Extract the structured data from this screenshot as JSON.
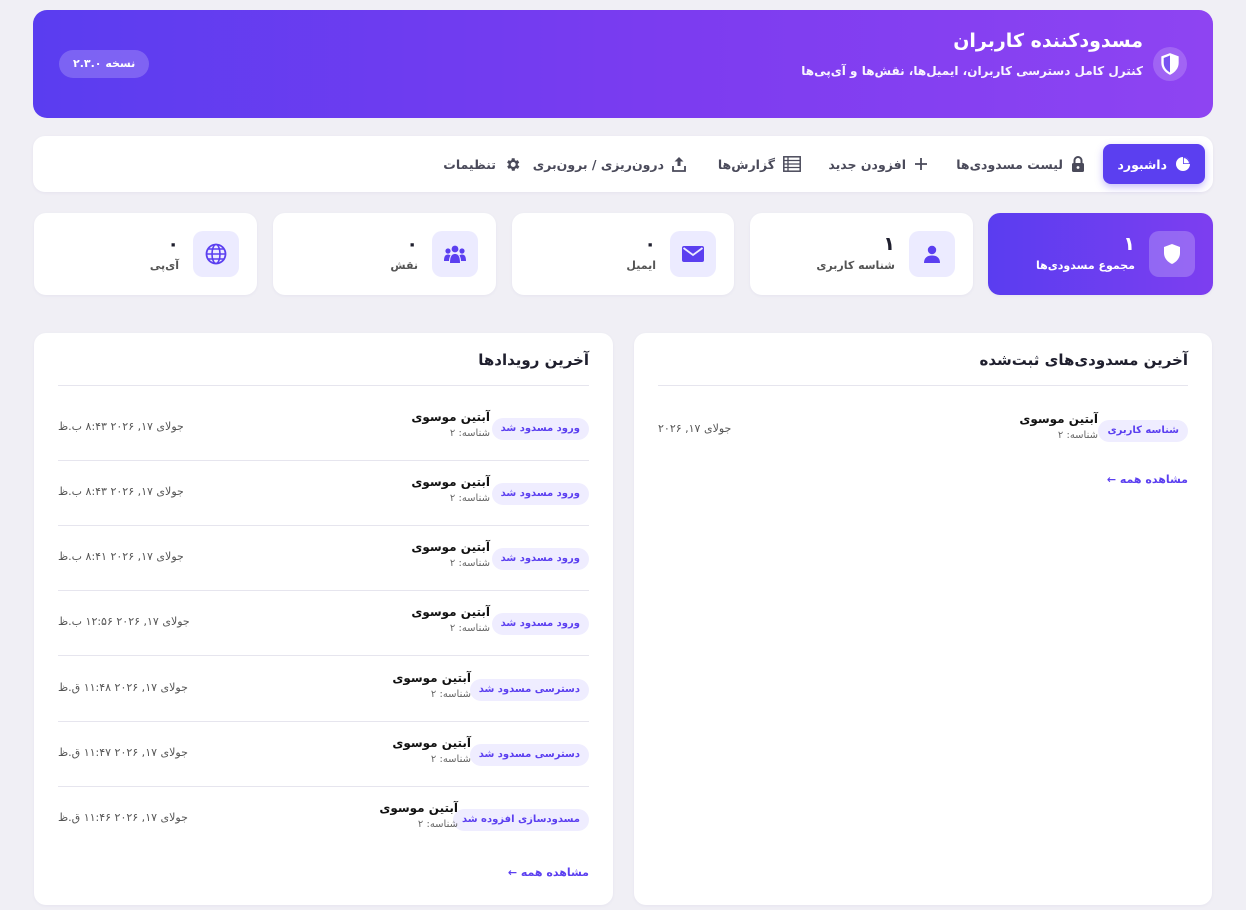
{
  "header": {
    "title": "مسدودکننده کاربران",
    "subtitle": "کنترل کامل دسترسی کاربران، ایمیل‌ها، نقش‌ها و آی‌پی‌ها",
    "version": "نسخه ۲.۳.۰"
  },
  "nav": {
    "dashboard": "داشبورد",
    "blocked_list": "لیست مسدودی‌ها",
    "add_new": "افزودن جدید",
    "reports": "گزارش‌ها",
    "import_export": "درون‌ریزی / برون‌بری",
    "settings": "تنظیمات"
  },
  "stats": [
    {
      "label": "مجموع مسدودی‌ها",
      "value": "۱"
    },
    {
      "label": "شناسه کاربری",
      "value": "۱"
    },
    {
      "label": "ایمیل",
      "value": "۰"
    },
    {
      "label": "نقش",
      "value": "۰"
    },
    {
      "label": "آی‌پی",
      "value": "۰"
    }
  ],
  "recent_blocks": {
    "title": "آخرین مسدودی‌های ثبت‌شده",
    "items": [
      {
        "type": "شناسه کاربری",
        "name": "آبتین موسوی",
        "ident": "شناسه: ۲",
        "date": "جولای ۱۷, ۲۰۲۶"
      }
    ],
    "see_all": "مشاهده همه ←"
  },
  "recent_events": {
    "title": "آخرین رویدادها",
    "items": [
      {
        "event": "ورود مسدود شد",
        "name": "آبتین موسوی",
        "ident": "شناسه: ۲",
        "date": "جولای ۱۷, ۲۰۲۶ ۸:۴۳ ب.ظ"
      },
      {
        "event": "ورود مسدود شد",
        "name": "آبتین موسوی",
        "ident": "شناسه: ۲",
        "date": "جولای ۱۷, ۲۰۲۶ ۸:۴۳ ب.ظ"
      },
      {
        "event": "ورود مسدود شد",
        "name": "آبتین موسوی",
        "ident": "شناسه: ۲",
        "date": "جولای ۱۷, ۲۰۲۶ ۸:۴۱ ب.ظ"
      },
      {
        "event": "ورود مسدود شد",
        "name": "آبتین موسوی",
        "ident": "شناسه: ۲",
        "date": "جولای ۱۷, ۲۰۲۶ ۱۲:۵۶ ب.ظ"
      },
      {
        "event": "دسترسی مسدود شد",
        "name": "آبتین موسوی",
        "ident": "شناسه: ۲",
        "date": "جولای ۱۷, ۲۰۲۶ ۱۱:۴۸ ق.ظ"
      },
      {
        "event": "دسترسی مسدود شد",
        "name": "آبتین موسوی",
        "ident": "شناسه: ۲",
        "date": "جولای ۱۷, ۲۰۲۶ ۱۱:۴۷ ق.ظ"
      },
      {
        "event": "مسدودسازی افزوده شد",
        "name": "آبتین موسوی",
        "ident": "شناسه: ۲",
        "date": "جولای ۱۷, ۲۰۲۶ ۱۱:۴۶ ق.ظ"
      }
    ],
    "see_all": "مشاهده همه ←"
  },
  "colors": {
    "accent": "#5b3ff0",
    "chip_bg": "#efedff",
    "page_bg": "#f0eff5"
  }
}
